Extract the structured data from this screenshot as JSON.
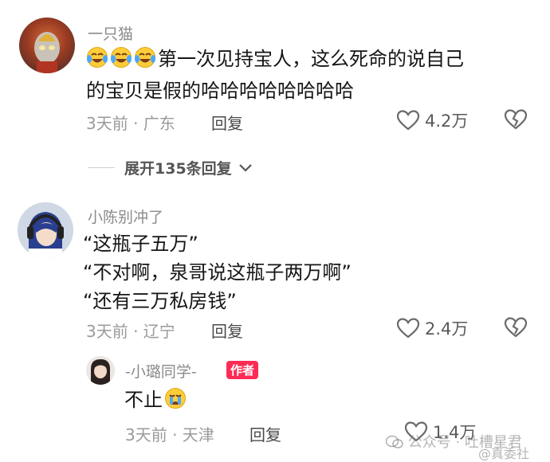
{
  "comments": [
    {
      "username": "一只猫",
      "text_line1": "第一次见持宝人，这么死命的说自己",
      "text_line2": "的宝贝是假的哈哈哈哈哈哈哈哈",
      "meta": "3天前 · 广东",
      "reply_label": "回复",
      "likes": "4.2万"
    },
    {
      "username": "小陈别冲了",
      "text_line1": "“这瓶子五万”",
      "text_line2": "“不对啊，泉哥说这瓶子两万啊”",
      "text_line3": "“还有三万私房钱”",
      "meta": "3天前 · 辽宁",
      "reply_label": "回复",
      "likes": "2.4万"
    }
  ],
  "expand_replies": "展开135条回复",
  "reply": {
    "username": "-小璐同学-",
    "badge": "作者",
    "text": "不止",
    "meta": "3天前 · 天津",
    "reply_label": "回复",
    "likes": "1.4万"
  },
  "watermark": "公众号 · 吐槽星君",
  "watermark_right": "@真委社"
}
